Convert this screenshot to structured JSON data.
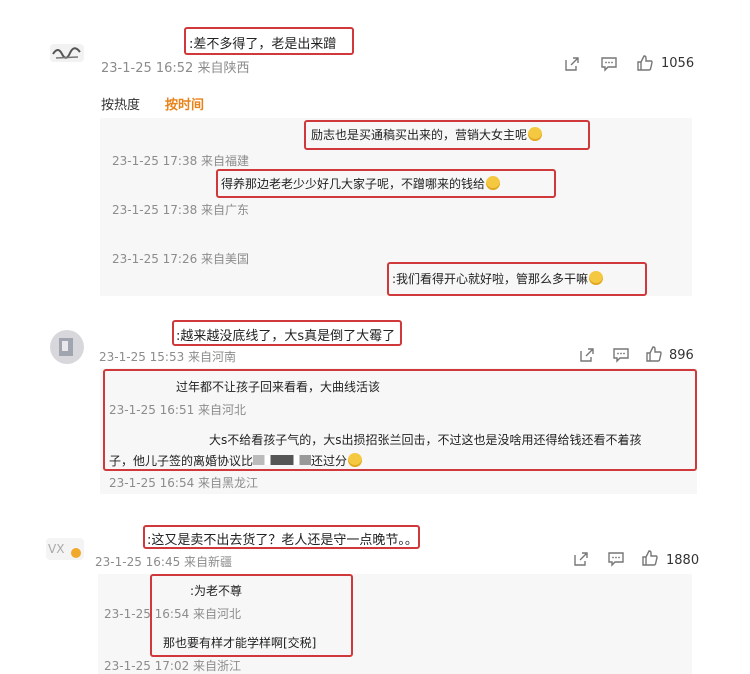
{
  "thread1": {
    "comment": ":差不多得了，老是出来蹭",
    "meta": "23-1-25 16:52 来自陕西",
    "likes": "1056",
    "sort_hot": "按热度",
    "sort_time": "按时间",
    "replies": [
      {
        "text": "励志也是买通稿买出来的，营销大女主呢",
        "meta": "23-1-25 17:38 来自福建"
      },
      {
        "text": "得养那边老老少少好几大家子呢，不蹭哪来的钱给",
        "meta": "23-1-25 17:38 来自广东"
      },
      {
        "meta": "23-1-25 17:26 来自美国"
      },
      {
        "text": ":我们看得开心就好啦，管那么多干嘛"
      }
    ]
  },
  "thread2": {
    "comment": ":越来越没底线了，大s真是倒了大霉了",
    "meta": "23-1-25 15:53 来自河南",
    "likes": "896",
    "replies": [
      {
        "text": "过年都不让孩子回来看看，大曲线活该",
        "meta": "23-1-25 16:51 来自河北"
      },
      {
        "text_line1": "大s不给看孩子气的，大s出损招张兰回击，不过这也是没啥用还得给钱还看不着孩",
        "text_line2": "子，他儿子签的离婚协议比",
        "text_tail": "还过分",
        "meta": "23-1-25 16:54 来自黑龙江"
      }
    ]
  },
  "thread3": {
    "comment": ":这又是卖不出去货了？老人还是守一点晚节。。",
    "meta": "23-1-25 16:45 来自新疆",
    "likes": "1880",
    "replies": [
      {
        "text": ":为老不尊",
        "meta": "23-1-25 16:54 来自河北"
      },
      {
        "text": "那也要有样才能学样啊[交税]",
        "meta": "23-1-25 17:02 来自浙江"
      }
    ]
  },
  "colors": {
    "highlight": "#d0393b",
    "sort_active": "#e8831a",
    "meta": "#8c8c8c"
  },
  "icons": [
    "share-icon",
    "comment-icon",
    "like-icon",
    "smiley-emoji"
  ]
}
